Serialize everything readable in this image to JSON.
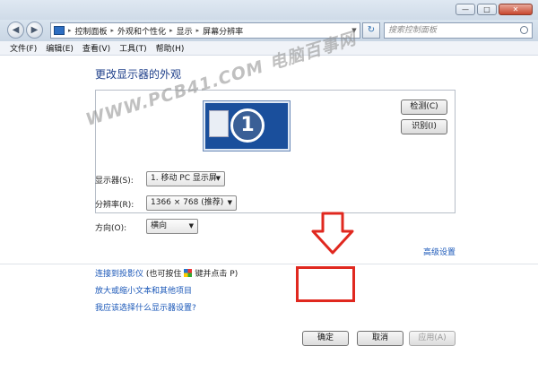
{
  "window": {
    "min_label": "—",
    "max_label": "□",
    "close_label": "✕"
  },
  "nav": {
    "back_glyph": "◀",
    "forward_glyph": "▶",
    "breadcrumb": [
      "控制面板",
      "外观和个性化",
      "显示",
      "屏幕分辨率"
    ],
    "refresh_glyph": "↻",
    "search_placeholder": "搜索控制面板"
  },
  "menu": [
    "文件(F)",
    "编辑(E)",
    "查看(V)",
    "工具(T)",
    "帮助(H)"
  ],
  "page": {
    "title": "更改显示器的外观",
    "monitor_number": "1",
    "detect_label": "检测(C)",
    "identify_label": "识别(I)",
    "display_label": "显示器(S):",
    "display_value": "1. 移动 PC 显示屏",
    "resolution_label": "分辨率(R):",
    "resolution_value": "1366 × 768 (推荐)",
    "orientation_label": "方向(O):",
    "orientation_value": "横向",
    "advanced_link": "高级设置",
    "projector_link": "连接到投影仪",
    "projector_hint_pre": "(也可按住",
    "projector_hint_post": "键并点击 P)",
    "enlarge_link": "放大或缩小文本和其他项目",
    "which_link": "我应该选择什么显示器设置?"
  },
  "footer": {
    "ok_label": "确定",
    "cancel_label": "取消",
    "apply_label": "应用(A)"
  },
  "watermark": "WWW.PCB41.COM 电脑百事网",
  "colors": {
    "link": "#1a57b8",
    "title": "#1e3f8a",
    "highlight": "#e0281f"
  }
}
